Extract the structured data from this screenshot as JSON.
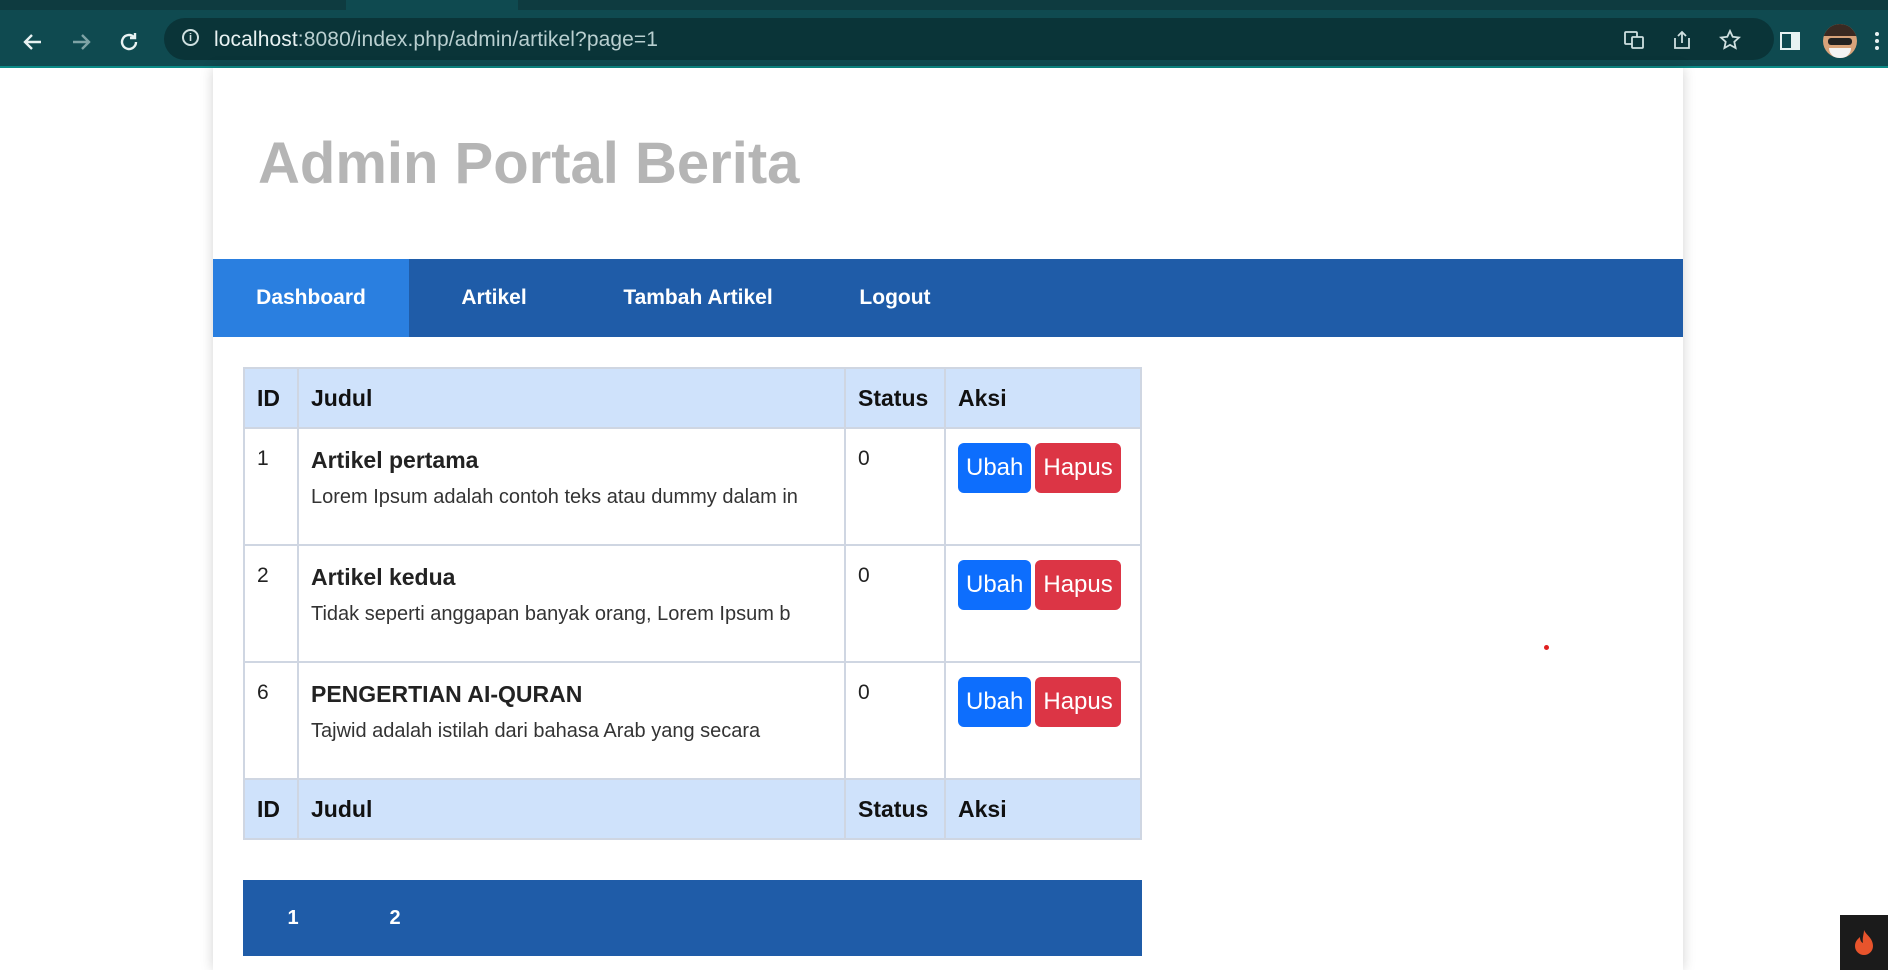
{
  "browser": {
    "url_host": "localhost",
    "url_rest": ":8080/index.php/admin/artikel?page=1"
  },
  "site": {
    "title": "Admin Portal Berita"
  },
  "nav": {
    "items": [
      {
        "label": "Dashboard",
        "active": true
      },
      {
        "label": "Artikel",
        "active": false
      },
      {
        "label": "Tambah Artikel",
        "active": false
      },
      {
        "label": "Logout",
        "active": false
      }
    ]
  },
  "table": {
    "headers": [
      "ID",
      "Judul",
      "Status",
      "Aksi"
    ],
    "footers": [
      "ID",
      "Judul",
      "Status",
      "Aksi"
    ],
    "rows": [
      {
        "id": "1",
        "title": "Artikel pertama",
        "excerpt": "Lorem Ipsum adalah contoh teks atau dummy dalam in",
        "status": "0",
        "edit": "Ubah",
        "delete": "Hapus"
      },
      {
        "id": "2",
        "title": "Artikel kedua",
        "excerpt": "Tidak seperti anggapan banyak orang, Lorem Ipsum b",
        "status": "0",
        "edit": "Ubah",
        "delete": "Hapus"
      },
      {
        "id": "6",
        "title": "PENGERTIAN AI-QURAN",
        "excerpt": "Tajwid adalah istilah dari bahasa Arab yang secara",
        "status": "0",
        "edit": "Ubah",
        "delete": "Hapus"
      }
    ]
  },
  "pagination": {
    "pages": [
      "1",
      "2"
    ]
  },
  "colors": {
    "navbar": "#1f5ca8",
    "nav_active": "#2a7fe0",
    "header_row": "#cfe2fb",
    "btn_ubah": "#0d6efd",
    "btn_hapus": "#dc3545"
  }
}
